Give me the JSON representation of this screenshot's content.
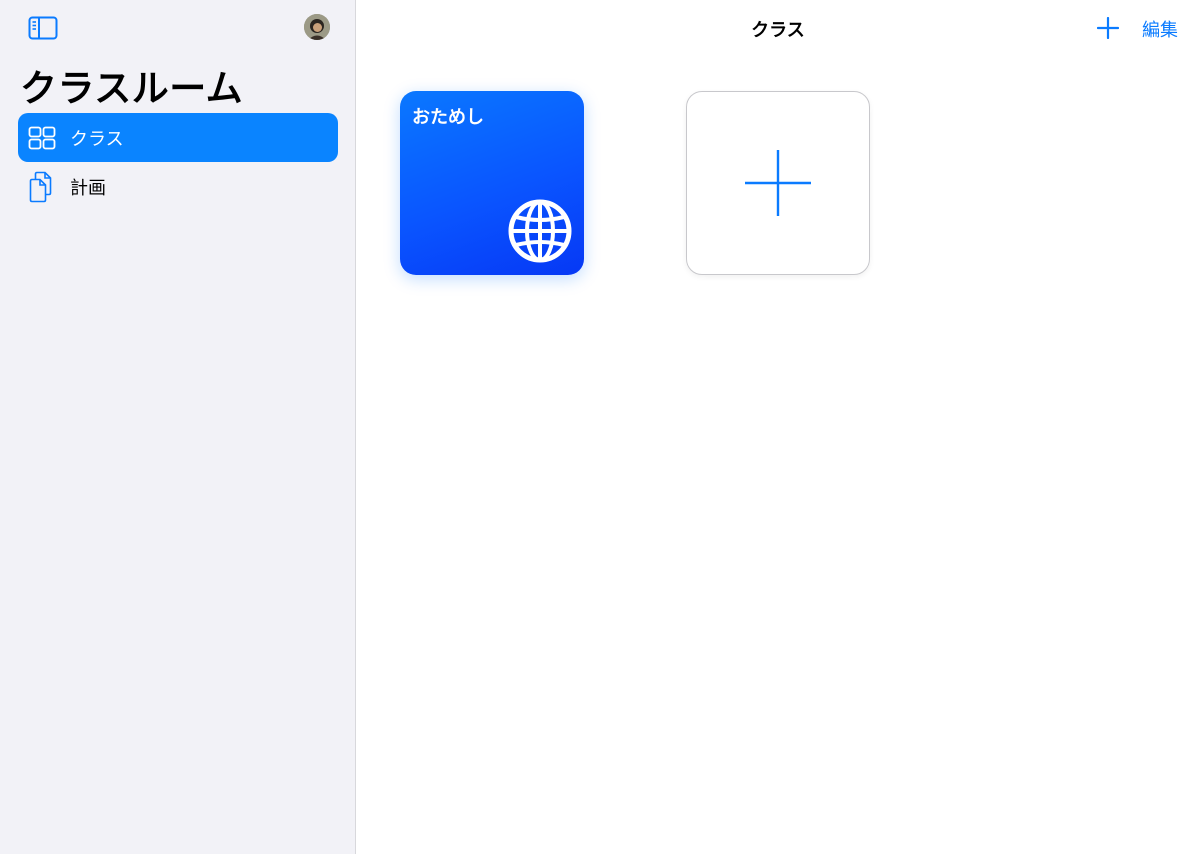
{
  "sidebar": {
    "title": "クラスルーム",
    "items": [
      {
        "label": "クラス",
        "icon": "grid-icon",
        "selected": true
      },
      {
        "label": "計画",
        "icon": "documents-icon",
        "selected": false
      }
    ]
  },
  "main": {
    "title": "クラス",
    "edit_label": "編集",
    "classes": [
      {
        "name": "おためし",
        "icon": "globe-icon"
      }
    ]
  },
  "colors": {
    "accent": "#0a84ff",
    "sidebar_bg": "#f2f2f7"
  }
}
